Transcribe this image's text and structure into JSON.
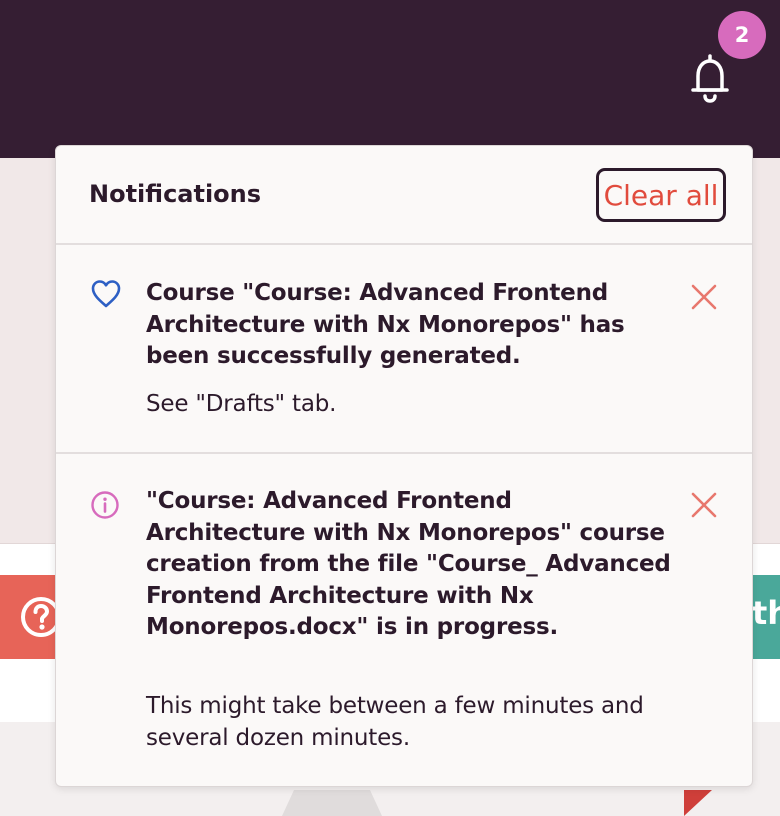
{
  "colors": {
    "topbar": "#351e33",
    "badge": "#d76bbd",
    "accent_red": "#e14b3d",
    "heart_blue": "#2d5fc4",
    "info_pink": "#d76bbd",
    "text_dark": "#2c1a2b"
  },
  "header": {
    "notification_count": "2",
    "bell_icon": "bell-icon"
  },
  "background": {
    "teal_button_text": "th",
    "help_icon": "question-circle-icon"
  },
  "notifications": {
    "title": "Notifications",
    "clear_all_label": "Clear all",
    "items": [
      {
        "icon": "heart-icon",
        "title": "Course \"Course: Advanced Frontend Architecture with Nx Monorepos\" has been successfully generated.",
        "body": "See \"Drafts\" tab."
      },
      {
        "icon": "info-icon",
        "title": "\"Course: Advanced Frontend Architecture with Nx Monorepos\" course creation from the file \"Course_ Advanced Frontend Architecture with Nx Monorepos.docx\" is in progress.",
        "body": "This might take between a few minutes and several dozen minutes."
      }
    ]
  }
}
